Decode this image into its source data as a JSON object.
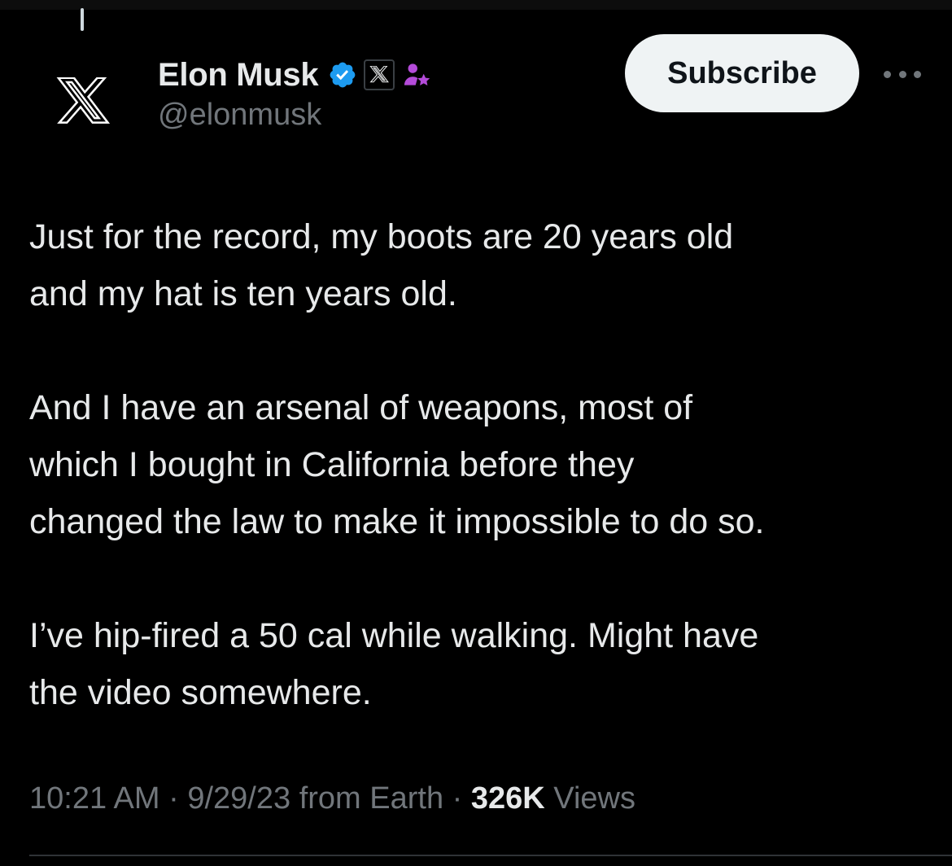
{
  "author": {
    "display_name": "Elon Musk",
    "handle": "@elonmusk",
    "avatar_icon": "x-logo-icon",
    "verified_badge_icon": "verified-badge-icon",
    "affiliation_badge_icon": "x-affiliate-badge-icon",
    "subscriber_badge_icon": "subscriber-star-icon"
  },
  "actions": {
    "subscribe_label": "Subscribe",
    "more_icon": "more-horizontal-icon"
  },
  "tweet": {
    "paragraphs": [
      "Just for the record, my boots are 20 years old\nand my hat is ten years old.",
      "And I have an arsenal of weapons, most of\nwhich I bought in California before they\nchanged the law to make it impossible to do so.",
      "I’ve hip-fired a 50 cal while walking. Might have\nthe video somewhere."
    ],
    "time": "10:21 AM",
    "date": "9/29/23",
    "source": "from Earth",
    "separator": "·",
    "views_count": "326K",
    "views_label": "Views"
  },
  "colors": {
    "background": "#000000",
    "text": "#e7e9ea",
    "secondary_text": "#71767b",
    "verified_blue": "#1d9bf0",
    "subscriber_purple": "#b44bd9",
    "button_bg": "#eff3f4"
  }
}
